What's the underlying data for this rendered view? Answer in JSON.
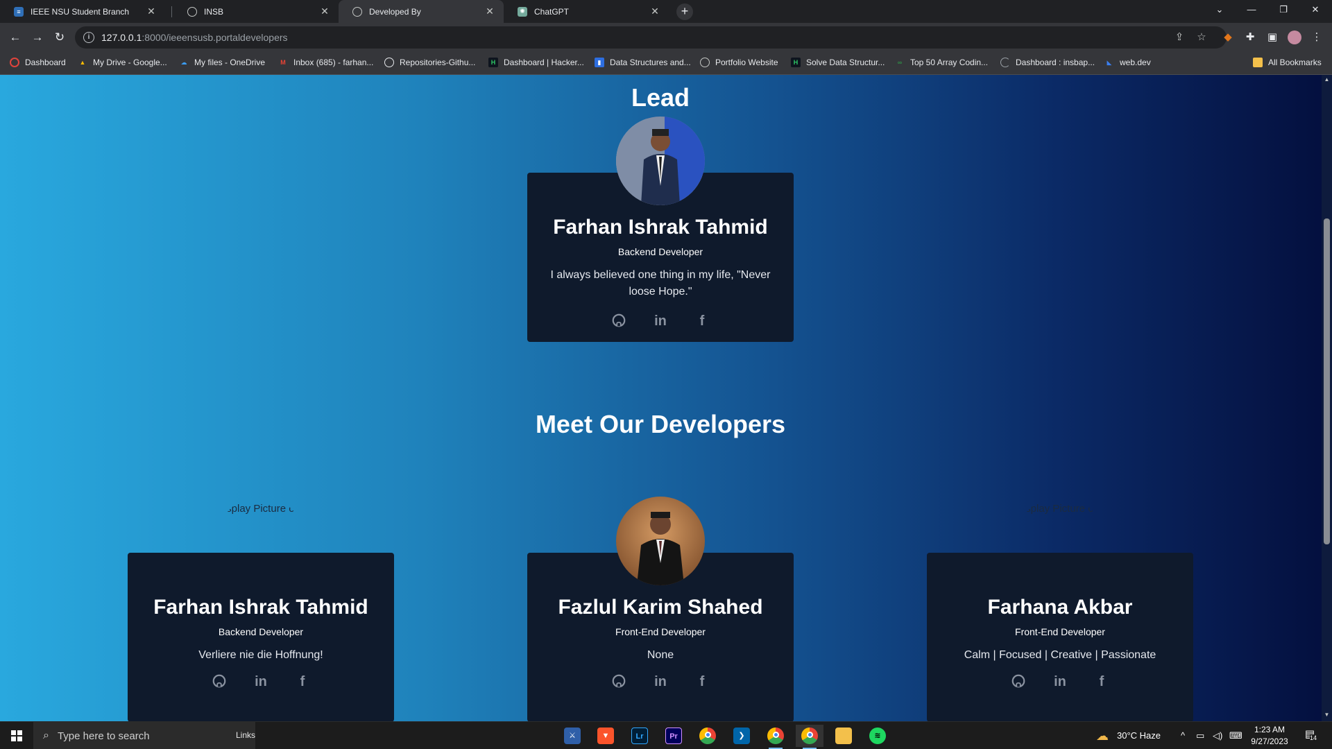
{
  "browser": {
    "tabs": [
      {
        "title": "IEEE NSU Student Branch",
        "active": false,
        "icon": "ieee-favicon"
      },
      {
        "title": "INSB",
        "active": false,
        "icon": "globe-icon"
      },
      {
        "title": "Developed By",
        "active": true,
        "icon": "globe-icon"
      },
      {
        "title": "ChatGPT",
        "active": false,
        "icon": "chatgpt-icon"
      }
    ],
    "url_host": "127.0.0.1",
    "url_path": ":8000/ieeensusb.portaldevelopers",
    "bookmarks": [
      {
        "label": "Dashboard",
        "icon": "red-ring-icon"
      },
      {
        "label": "My Drive - Google...",
        "icon": "drive-icon"
      },
      {
        "label": "My files - OneDrive",
        "icon": "onedrive-icon"
      },
      {
        "label": "Inbox (685) - farhan...",
        "icon": "gmail-icon"
      },
      {
        "label": "Repositories-Githu...",
        "icon": "github-icon"
      },
      {
        "label": "Dashboard | Hacker...",
        "icon": "hackerrank-icon"
      },
      {
        "label": "Data Structures and...",
        "icon": "bookmark-icon"
      },
      {
        "label": "Portfolio Website",
        "icon": "globe-icon"
      },
      {
        "label": "Solve Data Structur...",
        "icon": "hackerrank-icon"
      },
      {
        "label": "Top 50 Array Codin...",
        "icon": "gfg-icon"
      },
      {
        "label": "Dashboard : insbap...",
        "icon": "half-circle-icon"
      },
      {
        "label": "web.dev",
        "icon": "webdev-icon"
      }
    ],
    "all_bookmarks": "All Bookmarks"
  },
  "page": {
    "lead_heading": "Lead",
    "lead_card": {
      "name": "Farhan Ishrak Tahmid",
      "role": "Backend Developer",
      "quote": "I always believed one thing in my life, \"Never loose Hope.\""
    },
    "developers_heading": "Meet Our Developers",
    "developers": [
      {
        "name": "Farhan Ishrak Tahmid",
        "role": "Backend Developer",
        "quote": "Verliere nie die Hoffnung!",
        "avatar_alt": "Display Picture of Andres Berlin",
        "has_photo": false
      },
      {
        "name": "Fazlul Karim Shahed",
        "role": "Front-End Developer",
        "quote": "None",
        "has_photo": true
      },
      {
        "name": "Farhana Akbar",
        "role": "Front-End Developer",
        "quote": "Calm | Focused | Creative | Passionate",
        "avatar_alt": "Display Picture of Andres Berlin",
        "has_photo": false
      }
    ],
    "social_icons": [
      "github-icon",
      "linkedin-icon",
      "facebook-icon"
    ]
  },
  "taskbar": {
    "search_placeholder": "Type here to search",
    "links_label": "Links",
    "weather": "30°C  Haze",
    "time": "1:23 AM",
    "date": "9/27/2023",
    "notification_count": "14"
  },
  "colors": {
    "gradient_start": "#29a8de",
    "gradient_end": "#04103f",
    "card_bg": "#0f1a2c",
    "social_icon": "#8b93a1"
  }
}
